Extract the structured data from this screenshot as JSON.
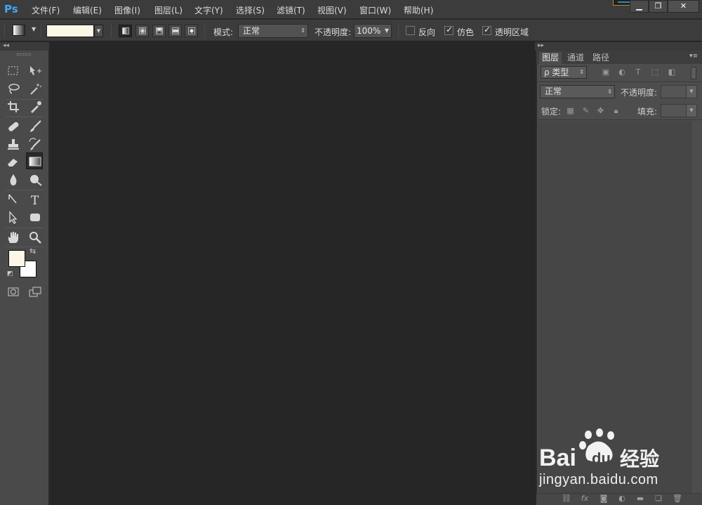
{
  "app": {
    "logo": "Ps"
  },
  "menu": [
    {
      "label": "文件(F)"
    },
    {
      "label": "编辑(E)"
    },
    {
      "label": "图像(I)"
    },
    {
      "label": "图层(L)"
    },
    {
      "label": "文字(Y)"
    },
    {
      "label": "选择(S)"
    },
    {
      "label": "滤镜(T)"
    },
    {
      "label": "视图(V)"
    },
    {
      "label": "窗口(W)"
    },
    {
      "label": "帮助(H)"
    }
  ],
  "options": {
    "mode_label": "模式:",
    "mode_value": "正常",
    "opacity_label": "不透明度:",
    "opacity_value": "100%",
    "reverse_label": "反向",
    "dither_label": "仿色",
    "transparency_label": "透明区域",
    "reverse_checked": false,
    "dither_checked": true,
    "transparency_checked": true,
    "gradient_type_active": "linear",
    "gradient_color": "#fdf7e6"
  },
  "colors": {
    "foreground": "#fdf7e6",
    "background": "#ffffff"
  },
  "layers_panel": {
    "tabs": [
      {
        "label": "图层"
      },
      {
        "label": "通道"
      },
      {
        "label": "路径"
      }
    ],
    "active_tab": "图层",
    "filter_label": "ρ 类型",
    "blend_mode": "正常",
    "opacity_label": "不透明度:",
    "lock_label": "锁定:",
    "fill_label": "填充:"
  },
  "watermark": {
    "brand": "Bai 经验",
    "url": "jingyan.baidu.com"
  }
}
